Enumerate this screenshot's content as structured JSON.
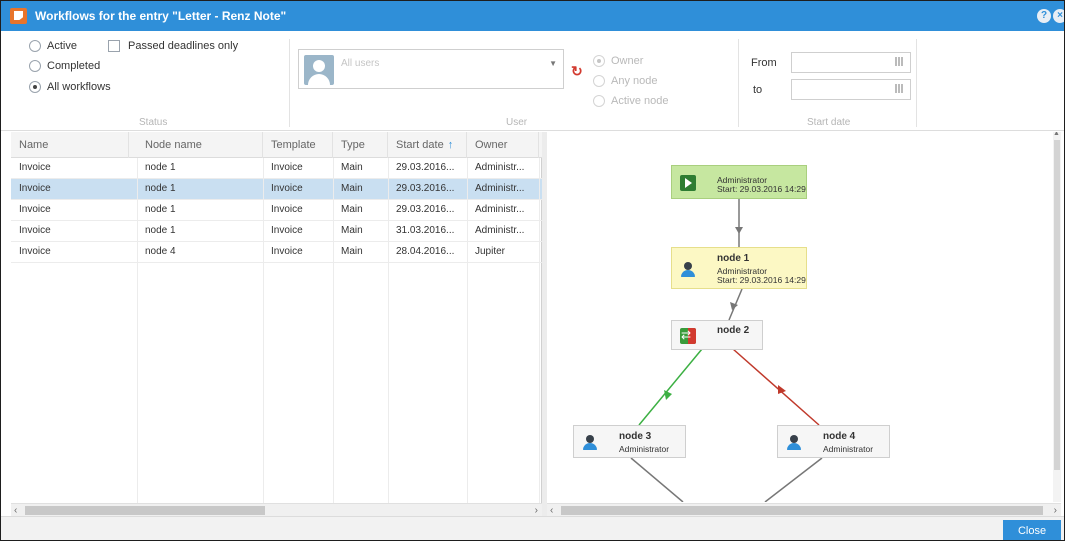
{
  "window": {
    "title": "Workflows for the entry \"Letter - Renz Note\""
  },
  "status_group": {
    "caption": "Status",
    "options": [
      {
        "label": "Active",
        "selected": false
      },
      {
        "label": "Completed",
        "selected": false
      },
      {
        "label": "All workflows",
        "selected": true
      }
    ],
    "passed_deadlines_label": "Passed deadlines only"
  },
  "user_group": {
    "caption": "User",
    "select_placeholder": "All users",
    "scope_options": [
      {
        "label": "Owner",
        "selected": true
      },
      {
        "label": "Any node",
        "selected": false
      },
      {
        "label": "Active node",
        "selected": false
      }
    ]
  },
  "date_group": {
    "caption": "Start date",
    "from_label": "From",
    "to_label": "to"
  },
  "grid": {
    "columns": [
      "Name",
      "Node name",
      "Template",
      "Type",
      "Start date",
      "Owner"
    ],
    "sort_column": "Start date",
    "rows": [
      [
        "Invoice",
        "node 1",
        "Invoice",
        "Main",
        "29.03.2016...",
        "Administr..."
      ],
      [
        "Invoice",
        "node 1",
        "Invoice",
        "Main",
        "29.03.2016...",
        "Administr..."
      ],
      [
        "Invoice",
        "node 1",
        "Invoice",
        "Main",
        "29.03.2016...",
        "Administr..."
      ],
      [
        "Invoice",
        "node 1",
        "Invoice",
        "Main",
        "31.03.2016...",
        "Administr..."
      ],
      [
        "Invoice",
        "node 4",
        "Invoice",
        "Main",
        "28.04.2016...",
        "Jupiter"
      ]
    ],
    "selected_row": 1
  },
  "flow": {
    "start": {
      "line1": "Administrator",
      "line2": "Start: 29.03.2016 14:29"
    },
    "node1": {
      "title": "node 1",
      "line1": "Administrator",
      "line2": "Start: 29.03.2016 14:29"
    },
    "node2": {
      "title": "node 2"
    },
    "node3": {
      "title": "node 3",
      "line1": "Administrator"
    },
    "node4": {
      "title": "node 4",
      "line1": "Administrator"
    },
    "colors": {
      "start": "#c6e7a0",
      "active": "#fcf8c4",
      "green_edge": "#3cb043",
      "red_edge": "#c0392b",
      "gray_edge": "#777777"
    }
  },
  "footer": {
    "close_label": "Close"
  },
  "theme": {
    "accent": "#2f8fd9"
  }
}
